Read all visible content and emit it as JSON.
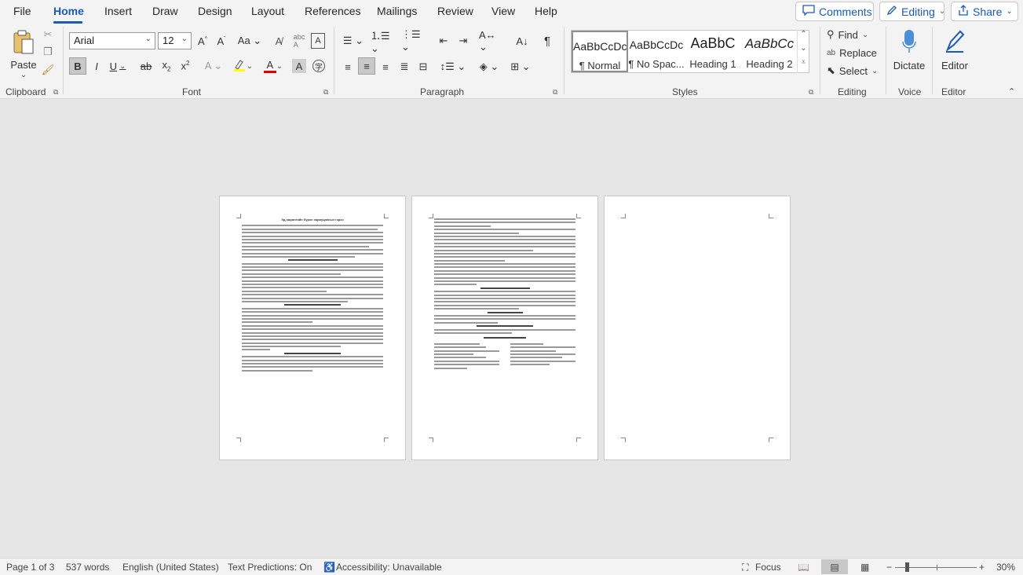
{
  "menu": {
    "tabs": [
      "File",
      "Home",
      "Insert",
      "Draw",
      "Design",
      "Layout",
      "References",
      "Mailings",
      "Review",
      "View",
      "Help"
    ],
    "active": "Home",
    "comments_label": "Comments",
    "editing_label": "Editing",
    "share_label": "Share"
  },
  "clipboard": {
    "paste_label": "Paste",
    "group_label": "Clipboard"
  },
  "font": {
    "name": "Arial",
    "size": "12",
    "group_label": "Font"
  },
  "paragraph": {
    "group_label": "Paragraph"
  },
  "styles": {
    "group_label": "Styles",
    "items": [
      {
        "sample": "AaBbCcDc",
        "name": "¶ Normal"
      },
      {
        "sample": "AaBbCcDc",
        "name": "¶ No Spac..."
      },
      {
        "sample": "AaBbC",
        "name": "Heading 1"
      },
      {
        "sample": "AaBbCc",
        "name": "Heading 2"
      }
    ]
  },
  "editing_group": {
    "find_label": "Find",
    "replace_label": "Replace",
    "select_label": "Select",
    "group_label": "Editing"
  },
  "voice": {
    "dictate_label": "Dictate",
    "group_label": "Voice"
  },
  "editor": {
    "editor_label": "Editor",
    "group_label": "Editor"
  },
  "document": {
    "page1_title": "Эд хөрөнгийн бүрэн хариуцлагын гэрээ"
  },
  "status": {
    "page": "Page 1 of 3",
    "words": "537 words",
    "language": "English (United States)",
    "predictions": "Text Predictions: On",
    "accessibility": "Accessibility: Unavailable",
    "focus": "Focus",
    "zoom": "30%"
  },
  "colors": {
    "accent": "#185abd",
    "highlight": "#ffff00",
    "font_color": "#e00000"
  }
}
